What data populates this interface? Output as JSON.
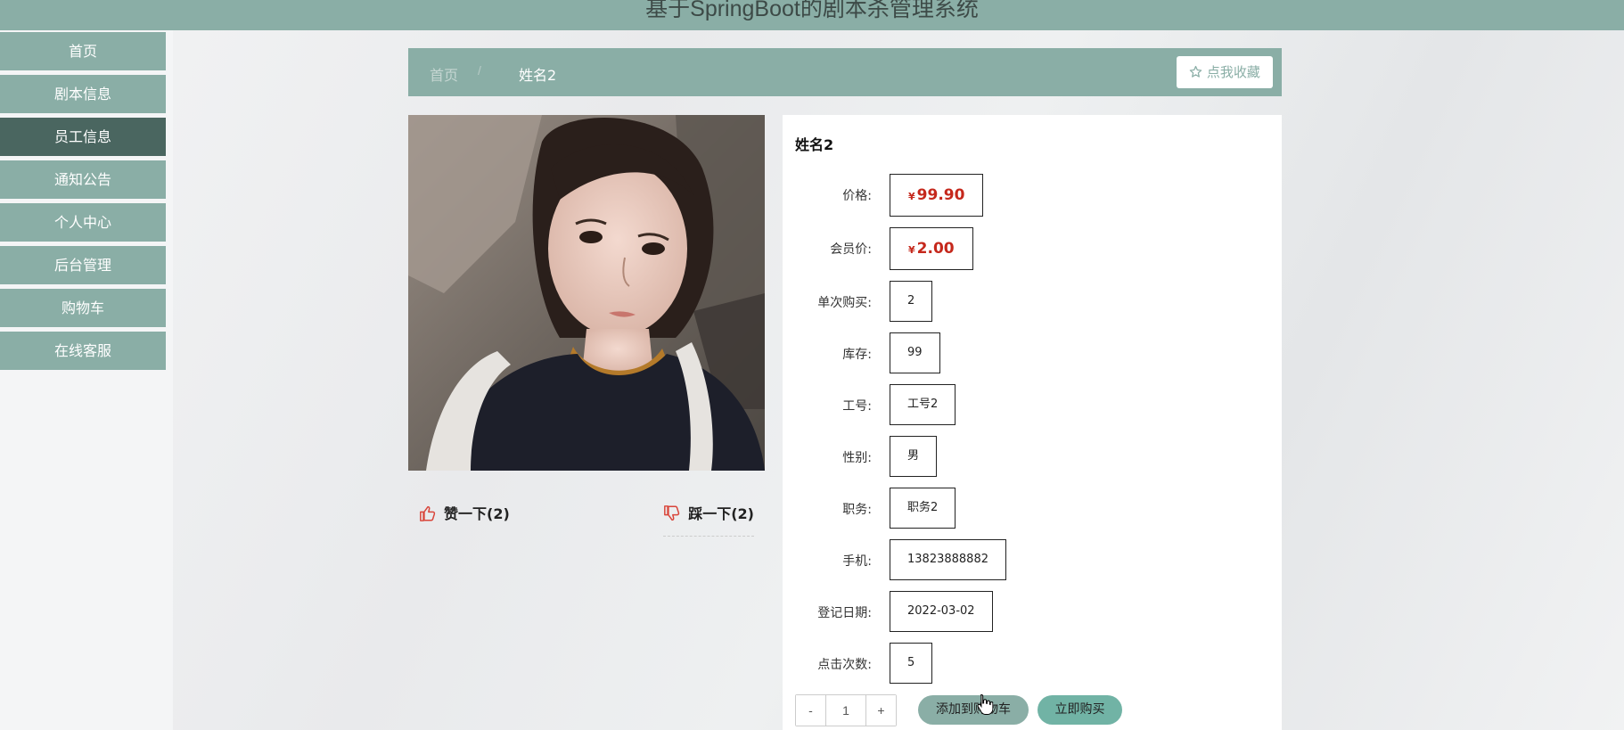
{
  "app": {
    "title": "基于SpringBoot的剧本杀管理系统"
  },
  "menu": {
    "items": [
      {
        "label": "首页"
      },
      {
        "label": "剧本信息"
      },
      {
        "label": "员工信息"
      },
      {
        "label": "通知公告"
      },
      {
        "label": "个人中心"
      },
      {
        "label": "后台管理"
      },
      {
        "label": "购物车"
      },
      {
        "label": "在线客服"
      }
    ],
    "active": "员工信息"
  },
  "breadcrumb": {
    "home": "首页",
    "separator": "/",
    "current": "姓名2"
  },
  "favorite": {
    "label": "点我收藏",
    "icon": "star-outline-icon"
  },
  "votes": {
    "like_label": "赞一下(2)",
    "dislike_label": "踩一下(2)"
  },
  "detail": {
    "name": "姓名2",
    "currency_symbol": "¥",
    "fields": [
      {
        "label": "价格:",
        "value": "99.90",
        "type": "price"
      },
      {
        "label": "会员价:",
        "value": "2.00",
        "type": "price"
      },
      {
        "label": "单次购买:",
        "value": "2"
      },
      {
        "label": "库存:",
        "value": "99"
      },
      {
        "label": "工号:",
        "value": "工号2"
      },
      {
        "label": "性别:",
        "value": "男"
      },
      {
        "label": "职务:",
        "value": "职务2"
      },
      {
        "label": "手机:",
        "value": "13823888882"
      },
      {
        "label": "登记日期:",
        "value": "2022-03-02"
      },
      {
        "label": "点击次数:",
        "value": "5"
      }
    ]
  },
  "quantity": {
    "minus": "-",
    "value": "1",
    "plus": "+"
  },
  "actions": {
    "add_to_cart": "添加到购物车",
    "buy_now": "立即购买"
  },
  "colors": {
    "primary": "#8aaea6",
    "active_menu": "#4a6660",
    "price": "#c5281c",
    "buy": "#71b3a5"
  }
}
